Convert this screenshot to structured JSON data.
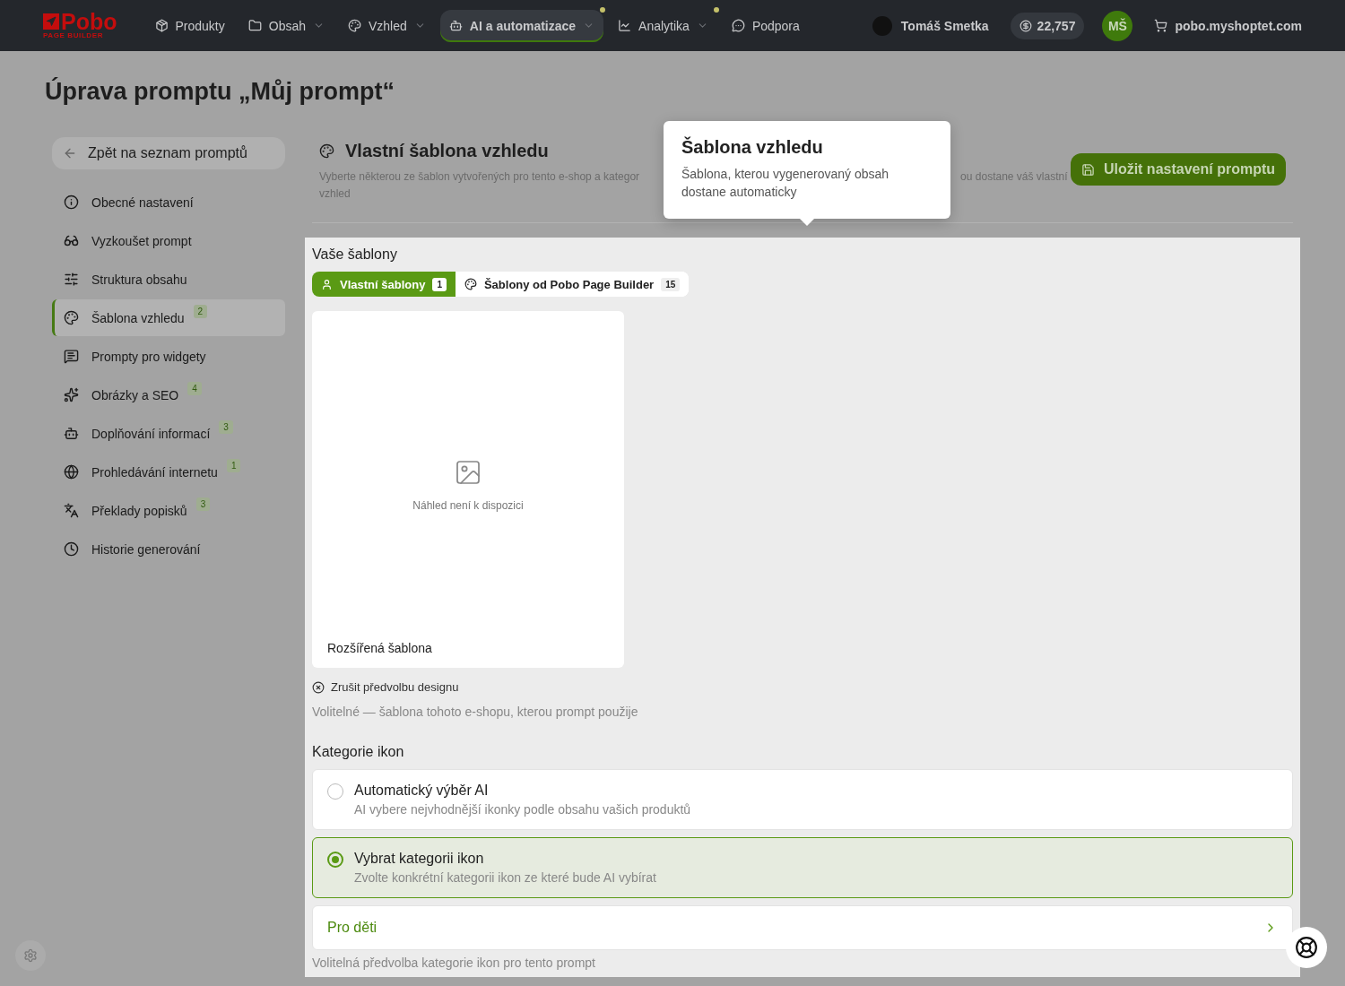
{
  "nav": {
    "logo": {
      "name": "Pobo",
      "sub": "PAGE BUILDER"
    },
    "items": [
      {
        "label": "Produkty",
        "dropdown": false,
        "selected": false,
        "dot": false
      },
      {
        "label": "Obsah",
        "dropdown": true,
        "selected": false,
        "dot": false
      },
      {
        "label": "Vzhled",
        "dropdown": true,
        "selected": false,
        "dot": false
      },
      {
        "label": "AI a automatizace",
        "dropdown": true,
        "selected": true,
        "dot": true
      },
      {
        "label": "Analytika",
        "dropdown": true,
        "selected": false,
        "dot": true
      },
      {
        "label": "Podpora",
        "dropdown": false,
        "selected": false,
        "dot": false
      }
    ],
    "user": "Tomáš Smetka",
    "credits": "22,757",
    "initials": "MŠ",
    "shop": "pobo.myshoptet.com"
  },
  "page_title": "Úprava promptu „Můj prompt“",
  "back_button": "Zpět na seznam promptů",
  "sidebar": {
    "items": [
      {
        "label": "Obecné nastavení",
        "selected": false
      },
      {
        "label": "Vyzkoušet prompt",
        "selected": false
      },
      {
        "label": "Struktura obsahu",
        "selected": false
      },
      {
        "label": "Šablona vzhledu",
        "badge": "2",
        "selected": true
      },
      {
        "label": "Prompty pro widgety",
        "selected": false
      },
      {
        "label": "Obrázky a SEO",
        "badge": "4",
        "selected": false
      },
      {
        "label": "Doplňování informací",
        "badge": "3",
        "selected": false
      },
      {
        "label": "Prohledávání internetu",
        "badge": "1",
        "selected": false
      },
      {
        "label": "Překlady popisků",
        "badge": "3",
        "selected": false
      },
      {
        "label": "Historie generování",
        "selected": false
      }
    ]
  },
  "section": {
    "title": "Vlastní šablona vzhledu",
    "description_start": "Vyberte některou ze šablon vytvořených pro tento e-shop a kategor",
    "description_end": "ou dostane váš vlastní",
    "description_line2": "vzhled"
  },
  "save_button": "Uložit nastavení promptu",
  "tooltip": {
    "title": "Šablona vzhledu",
    "text": "Šablona, kterou vygenerovaný obsah dostane automaticky"
  },
  "templates": {
    "heading": "Vaše šablony",
    "tabs": [
      {
        "label": "Vlastní šablony",
        "count": "1",
        "selected": true
      },
      {
        "label": "Šablony od Pobo Page Builder",
        "count": "15",
        "selected": false
      }
    ],
    "cards": [
      {
        "name": "Rozšířená šablona",
        "preview": "Náhled není k dispozici"
      }
    ],
    "clear": "Zrušit předvolbu designu",
    "hint": "Volitelné — šablona tohoto e-shopu, kterou prompt použije"
  },
  "icons": {
    "heading": "Kategorie ikon",
    "options": [
      {
        "title": "Automatický výběr AI",
        "description": "AI vybere nejvhodnější ikonky podle obsahu vašich produktů",
        "selected": false
      },
      {
        "title": "Vybrat kategorii ikon",
        "description": "Zvolte konkrétní kategorii ikon ze které bude AI vybírat",
        "selected": true
      }
    ],
    "category": "Pro děti",
    "hint": "Volitelná předvolba kategorie ikon pro tento prompt"
  }
}
